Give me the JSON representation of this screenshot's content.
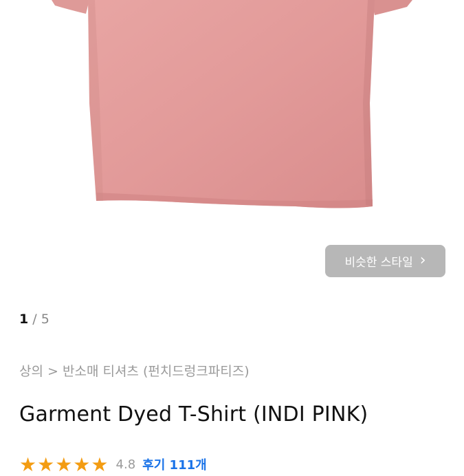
{
  "product": {
    "image_icon": "pink-tshirt-photo",
    "shirt_color": "#e8a0a0",
    "similar_button_label": "비슷한 스타일",
    "similar_button_icon": "chevron-right-icon",
    "image_index_current": "1",
    "image_index_separator": " / ",
    "image_index_total": "5",
    "breadcrumb": [
      "상의",
      ">",
      "반소매 티셔츠",
      "(펀치드렁크파티즈)"
    ],
    "title": "Garment Dyed T-Shirt (INDI PINK)",
    "rating_stars": "★★★★★",
    "rating_score": "4.8",
    "reviews_label": "후기 111개"
  }
}
